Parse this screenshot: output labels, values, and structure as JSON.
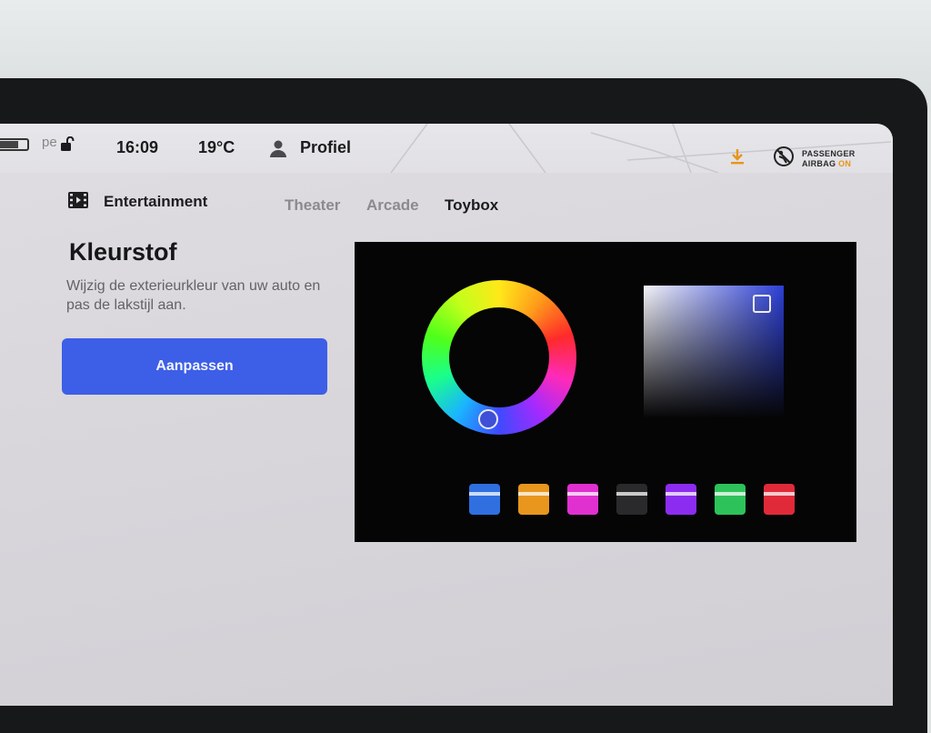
{
  "status_bar": {
    "battery_partial_text": "pe",
    "time": "16:09",
    "temperature": "19°C",
    "profile_label": "Profiel",
    "airbag_line1": "PASSENGER",
    "airbag_line2": "AIRBAG",
    "airbag_state": "ON",
    "download_color": "#e8951a"
  },
  "header": {
    "section_title": "Entertainment",
    "tabs": [
      {
        "label": "Theater",
        "active": false
      },
      {
        "label": "Arcade",
        "active": false
      },
      {
        "label": "Toybox",
        "active": true
      }
    ]
  },
  "content": {
    "heading": "Kleurstof",
    "description": "Wijzig de exterieurkleur van uw auto en pas de lakstijl aan.",
    "button_label": "Aanpassen",
    "button_color": "#3d5ee6"
  },
  "picker": {
    "selected_color": "#3e4fd8",
    "swatches": [
      {
        "name": "blue",
        "color": "#2f6fe0"
      },
      {
        "name": "orange",
        "color": "#e8961e"
      },
      {
        "name": "magenta",
        "color": "#e030d0"
      },
      {
        "name": "black",
        "color": "#2a2a2c"
      },
      {
        "name": "purple",
        "color": "#8c2cf0"
      },
      {
        "name": "green",
        "color": "#2ec25a"
      },
      {
        "name": "red",
        "color": "#e02a3a"
      }
    ]
  }
}
